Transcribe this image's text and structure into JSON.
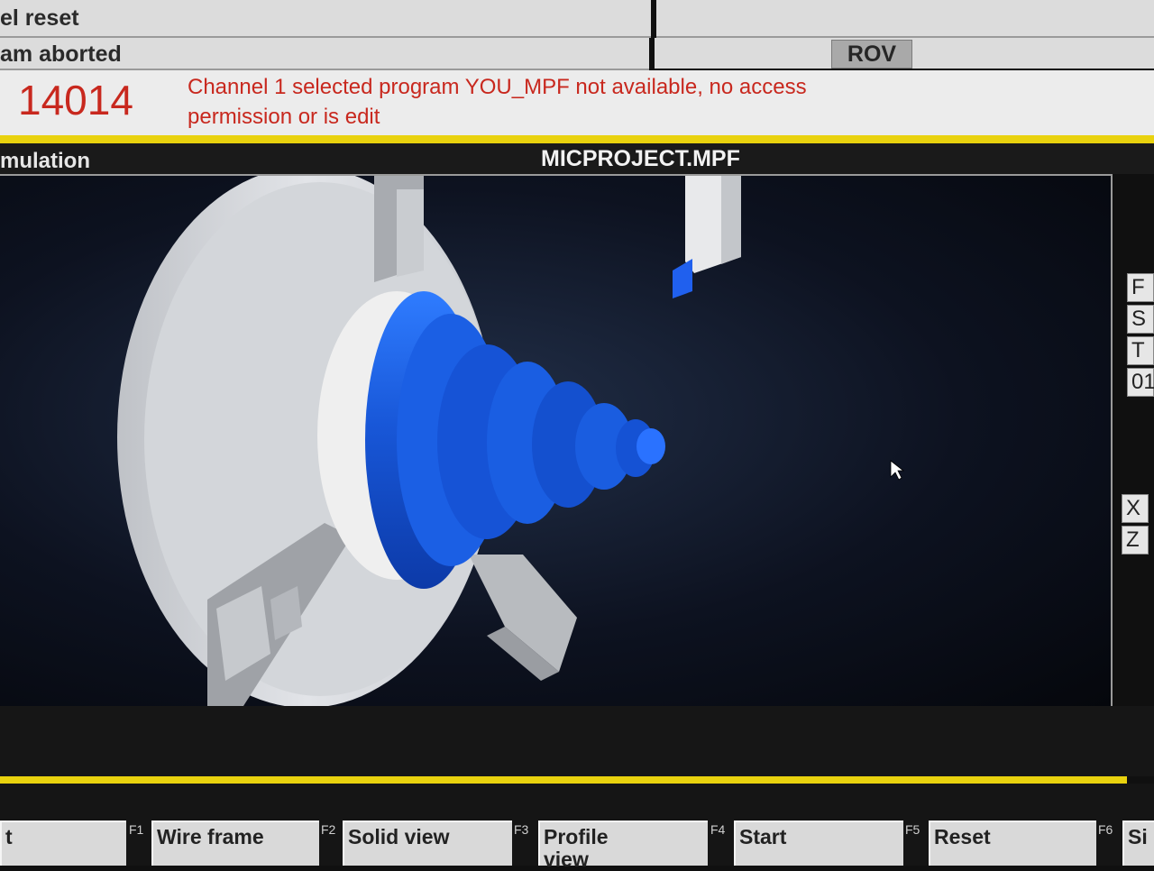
{
  "status": {
    "line1": "el reset",
    "line2": "am aborted",
    "mode_badge": "ROV"
  },
  "alarm": {
    "number": "14014",
    "message_line1": "Channel 1 selected program YOU_MPF not available, no access",
    "message_line2": "permission or is edit",
    "color": "#c8281e"
  },
  "simulation": {
    "label": "mulation",
    "program_name": "MICPROJECT.MPF"
  },
  "axis_panel": {
    "items": [
      "F",
      "S",
      "T",
      "01"
    ],
    "coords": [
      "X",
      "Z"
    ]
  },
  "softkeys": [
    {
      "label": "t",
      "fkey": "F1"
    },
    {
      "label": "Wire frame",
      "fkey": "F2"
    },
    {
      "label": "Solid view",
      "fkey": "F3"
    },
    {
      "label": "Profile view",
      "fkey": "F4"
    },
    {
      "label": "Start",
      "fkey": "F5"
    },
    {
      "label": "Reset",
      "fkey": "F6"
    },
    {
      "label": "Si",
      "fkey": ""
    }
  ],
  "colors": {
    "accent_yellow": "#e9d20e",
    "workpiece_blue": "#1a5fe0",
    "chuck_grey": "#d6d8dc"
  }
}
